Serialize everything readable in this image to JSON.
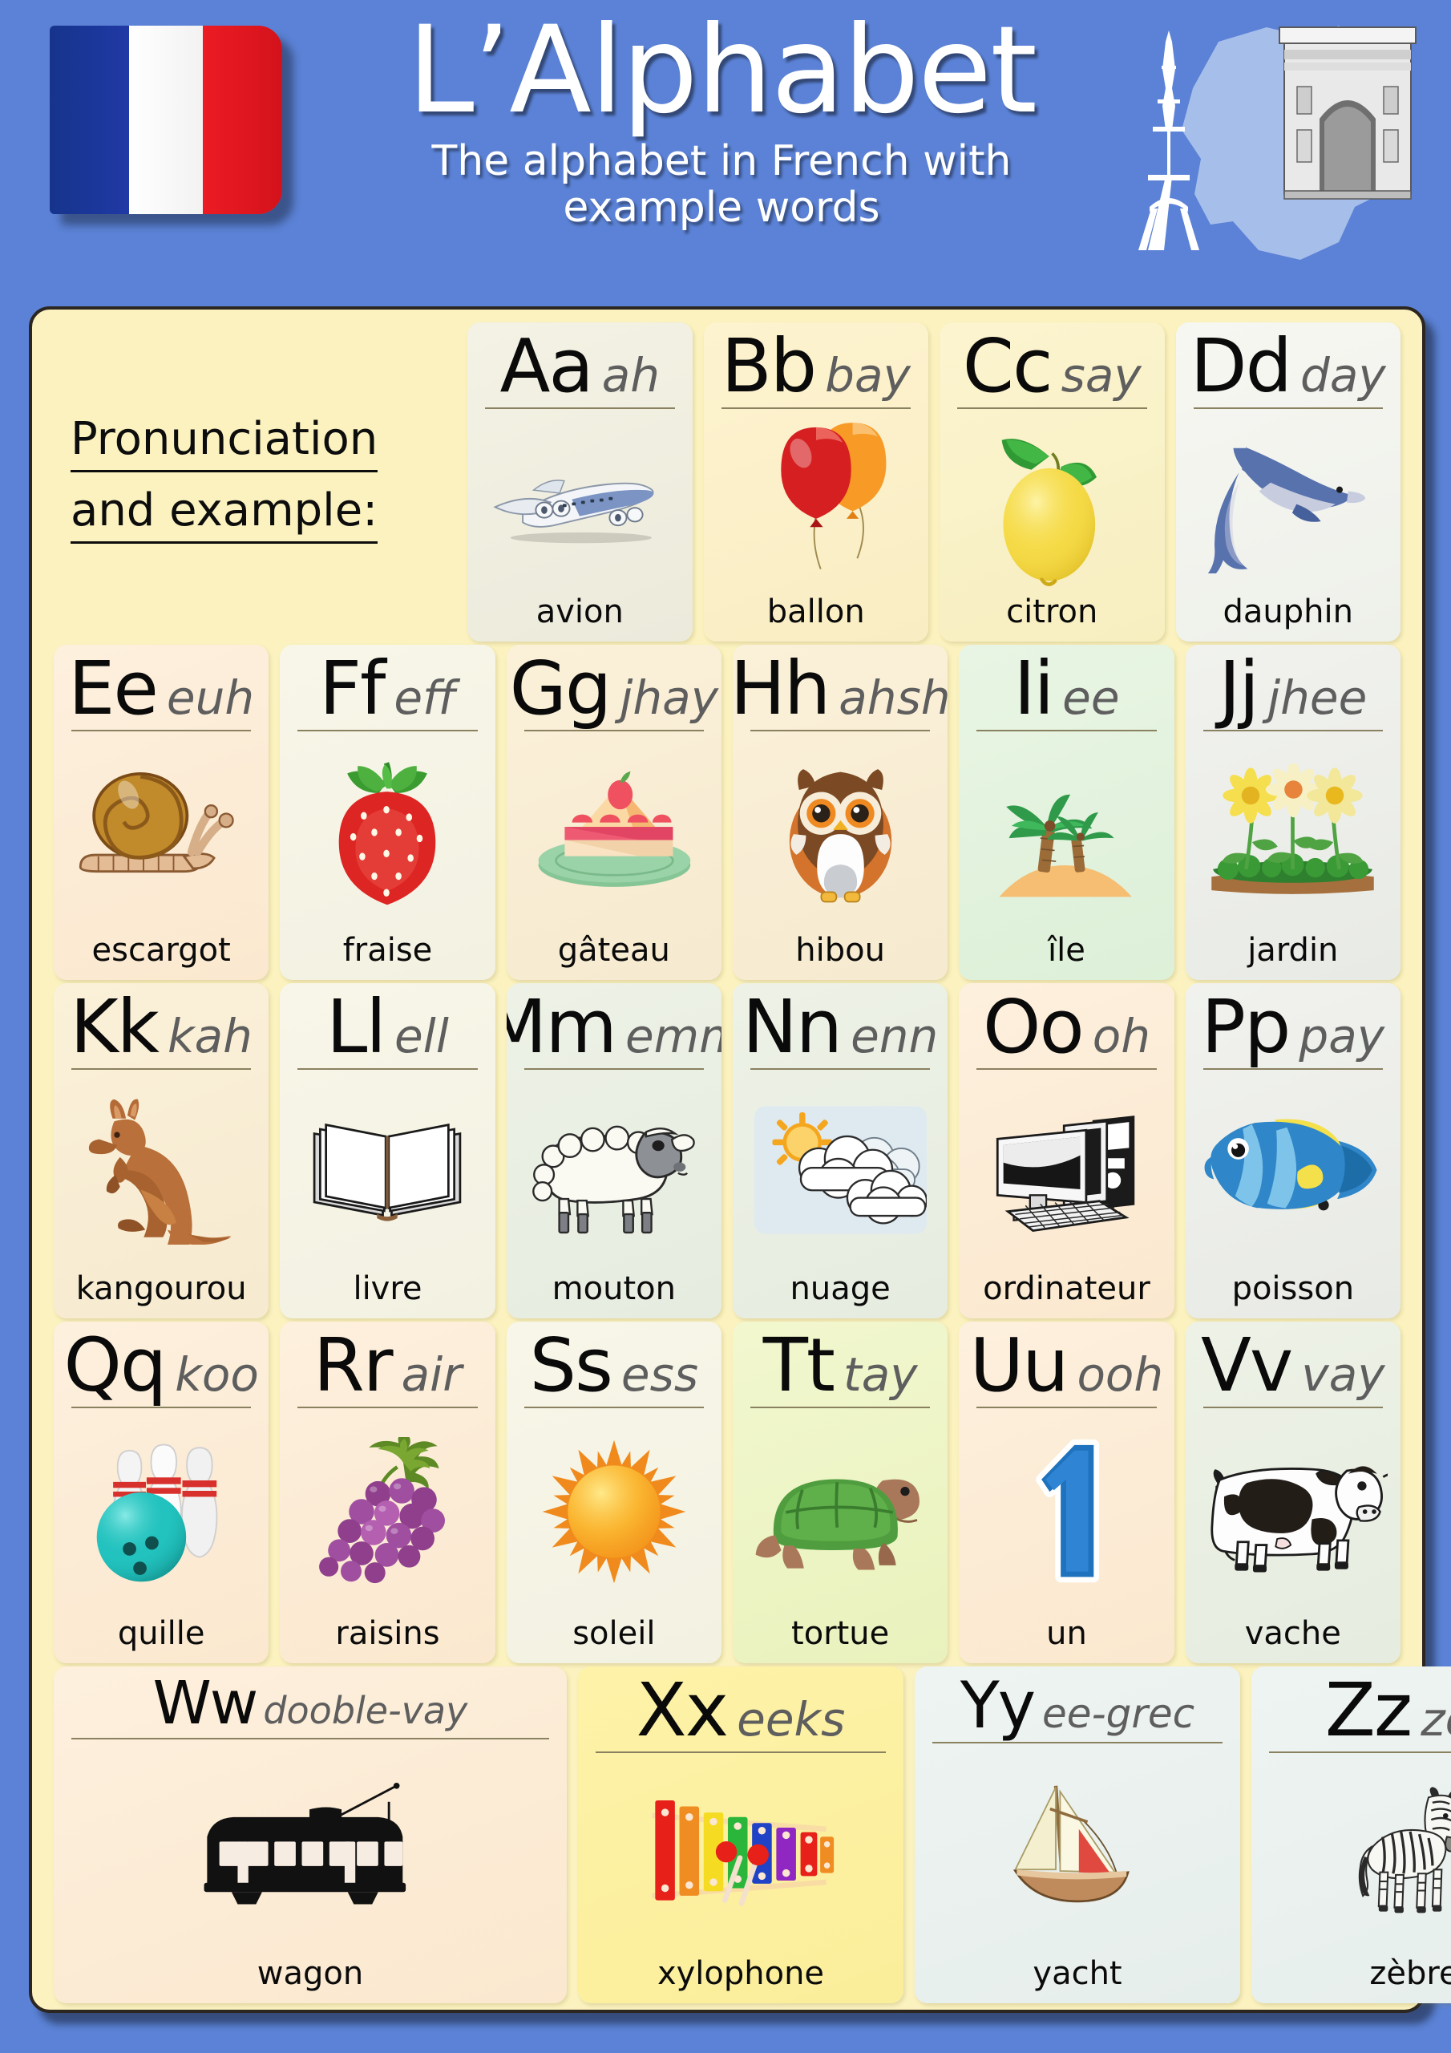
{
  "header": {
    "title": "L’Alphabet",
    "subtitle_line1": "The alphabet in French with",
    "subtitle_line2": "example words",
    "flag_name": "french-flag",
    "landmark_names": [
      "eiffel-tower-icon",
      "arc-de-triomphe-icon",
      "france-map-icon"
    ]
  },
  "intro": {
    "line1": "Pronunciation",
    "line2": "and example:"
  },
  "colors": {
    "page_background": "#5b82d6",
    "panel_background": "#fbf2bf",
    "panel_border": "#2c2620",
    "letter_text": "#0a0a0a",
    "pronunciation_text": "#5e5e5e",
    "word_text": "#0a0a0a",
    "rule_line": "#8a8160"
  },
  "rows": [
    {
      "index": 1,
      "cards": [
        {
          "letters": "Aa",
          "pron": "ah",
          "word": "avion",
          "icon": "airplane-icon",
          "tint": "t-cream"
        },
        {
          "letters": "Bb",
          "pron": "bay",
          "word": "ballon",
          "icon": "balloons-icon",
          "tint": "t-butter"
        },
        {
          "letters": "Cc",
          "pron": "say",
          "word": "citron",
          "icon": "lemon-icon",
          "tint": "t-lemon"
        },
        {
          "letters": "Dd",
          "pron": "day",
          "word": "dauphin",
          "icon": "dolphin-icon",
          "tint": "t-white"
        }
      ]
    },
    {
      "index": 2,
      "cards": [
        {
          "letters": "Ee",
          "pron": "euh",
          "word": "escargot",
          "icon": "snail-icon",
          "tint": "t-peach"
        },
        {
          "letters": "Ff",
          "pron": "eff",
          "word": "fraise",
          "icon": "strawberry-icon",
          "tint": "t-ivory"
        },
        {
          "letters": "Gg",
          "pron": "jhay",
          "word": "gâteau",
          "icon": "cake-icon",
          "tint": "t-sand"
        },
        {
          "letters": "Hh",
          "pron": "ahsh",
          "word": "hibou",
          "icon": "owl-icon",
          "tint": "t-sand"
        },
        {
          "letters": "Ii",
          "pron": "ee",
          "word": "île",
          "icon": "island-icon",
          "tint": "t-mint"
        },
        {
          "letters": "Jj",
          "pron": "jhee",
          "word": "jardin",
          "icon": "flowers-icon",
          "tint": "t-grey"
        }
      ]
    },
    {
      "index": 3,
      "cards": [
        {
          "letters": "Kk",
          "pron": "kah",
          "word": "kangourou",
          "icon": "kangaroo-icon",
          "tint": "t-sand"
        },
        {
          "letters": "Ll",
          "pron": "ell",
          "word": "livre",
          "icon": "book-icon",
          "tint": "t-ivory"
        },
        {
          "letters": "Mm",
          "pron": "emm",
          "word": "mouton",
          "icon": "sheep-icon",
          "tint": "t-sage"
        },
        {
          "letters": "Nn",
          "pron": "enn",
          "word": "nuage",
          "icon": "cloud-sun-icon",
          "tint": "t-sage"
        },
        {
          "letters": "Oo",
          "pron": "oh",
          "word": "ordinateur",
          "icon": "computer-icon",
          "tint": "t-peach"
        },
        {
          "letters": "Pp",
          "pron": "pay",
          "word": "poisson",
          "icon": "fish-icon",
          "tint": "t-grey"
        }
      ]
    },
    {
      "index": 4,
      "cards": [
        {
          "letters": "Qq",
          "pron": "koo",
          "word": "quille",
          "icon": "bowling-icon",
          "tint": "t-peach"
        },
        {
          "letters": "Rr",
          "pron": "air",
          "word": "raisins",
          "icon": "grapes-icon",
          "tint": "t-peach"
        },
        {
          "letters": "Ss",
          "pron": "ess",
          "word": "soleil",
          "icon": "sun-icon",
          "tint": "t-ivory"
        },
        {
          "letters": "Tt",
          "pron": "tay",
          "word": "tortue",
          "icon": "turtle-icon",
          "tint": "t-lime"
        },
        {
          "letters": "Uu",
          "pron": "ooh",
          "word": "un",
          "icon": "number-one-icon",
          "tint": "t-peach"
        },
        {
          "letters": "Vv",
          "pron": "vay",
          "word": "vache",
          "icon": "cow-icon",
          "tint": "t-sage"
        }
      ]
    },
    {
      "index": 5,
      "cards": [
        {
          "letters": "Ww",
          "pron": "dooble-vay",
          "word": "wagon",
          "icon": "tram-icon",
          "tint": "t-peach"
        },
        {
          "letters": "Xx",
          "pron": "eeks",
          "word": "xylophone",
          "icon": "xylophone-icon",
          "tint": "t-bright"
        },
        {
          "letters": "Yy",
          "pron": "ee-grec",
          "word": "yacht",
          "icon": "sailboat-icon",
          "tint": "t-ice"
        },
        {
          "letters": "Zz",
          "pron": "zed",
          "word": "zèbre",
          "icon": "zebra-icon",
          "tint": "t-ice"
        }
      ]
    }
  ]
}
